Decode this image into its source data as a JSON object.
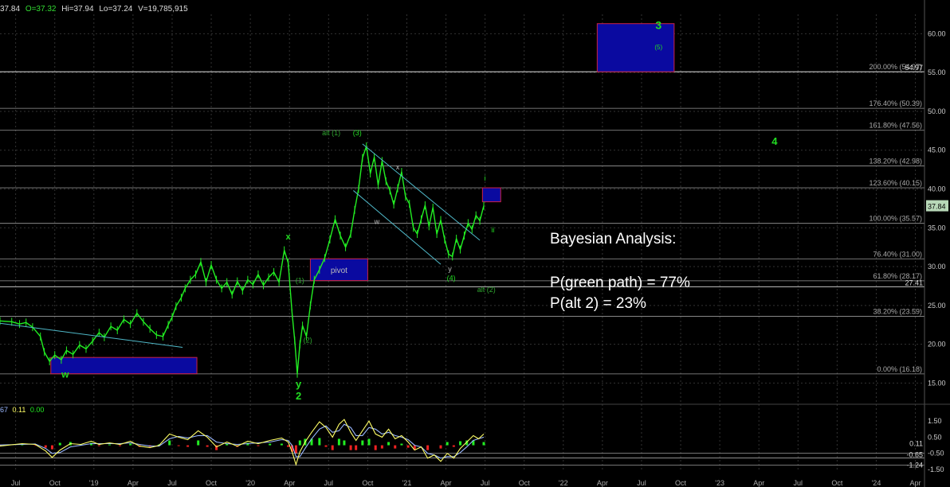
{
  "header": {
    "c_value": "37.84",
    "open": "O=37.32",
    "high": "Hi=37.94",
    "low": "Lo=37.24",
    "volume": "V=19,785,915"
  },
  "indicator_header": {
    "v1": "67",
    "v2": "0.11",
    "v3": "0.00"
  },
  "notes": {
    "title": "Bayesian Analysis:",
    "line1": "P(green path) = 77%",
    "line2": "P(alt 2) = 23%"
  },
  "colors": {
    "price": "#22ee22",
    "fib": "#9a9a9a",
    "box_fill": "#0a0aa0",
    "box_border": "#cc2244",
    "channel": "#4fb8c8",
    "label_green": "#22dd22",
    "label_dim_green": "#2fa52f",
    "label_gray": "#bbbbbb",
    "ind_fast": "#ffff66",
    "ind_slow": "#9ab8ff",
    "ind_pos": "#22ee22",
    "ind_neg": "#ee2222",
    "current_tag": "#b8d8b8"
  },
  "chart_data": [
    {
      "type": "line",
      "name": "price",
      "ylim": [
        13.5,
        62.5
      ],
      "y_ticks": [
        "60.00",
        "55.00",
        "50.00",
        "45.00",
        "40.00",
        "35.00",
        "30.00",
        "25.00",
        "20.00",
        "15.00"
      ],
      "y_tick_values": [
        60,
        55,
        50,
        45,
        40,
        35,
        30,
        25,
        20,
        15
      ],
      "x_ticks": [
        "Jul",
        "Oct",
        "'19",
        "Apr",
        "Jul",
        "Oct",
        "'20",
        "Apr",
        "Jul",
        "Oct",
        "'21",
        "Apr",
        "Jul",
        "Oct",
        "'22",
        "Apr",
        "Jul",
        "Oct",
        "'23",
        "Apr",
        "Jul",
        "Oct",
        "'24",
        "Apr"
      ],
      "x_tick_times": [
        0,
        3,
        6,
        9,
        12,
        15,
        18,
        21,
        24,
        27,
        30,
        33,
        36,
        39,
        42,
        45,
        48,
        51,
        54,
        57,
        60,
        63,
        66,
        69
      ],
      "x_range": [
        -1.2,
        69.7
      ],
      "series_points": [
        [
          -1.2,
          23.0
        ],
        [
          -0.3,
          22.9
        ],
        [
          0.3,
          22.6
        ],
        [
          0.8,
          22.8
        ],
        [
          1.3,
          22.2
        ],
        [
          1.9,
          21.0
        ],
        [
          2.2,
          19.0
        ],
        [
          2.6,
          17.8
        ],
        [
          3.0,
          18.6
        ],
        [
          3.5,
          18.0
        ],
        [
          3.9,
          19.2
        ],
        [
          4.4,
          18.7
        ],
        [
          4.9,
          19.9
        ],
        [
          5.4,
          19.4
        ],
        [
          5.9,
          20.4
        ],
        [
          6.4,
          21.5
        ],
        [
          6.8,
          20.9
        ],
        [
          7.3,
          22.3
        ],
        [
          7.8,
          21.8
        ],
        [
          8.3,
          23.2
        ],
        [
          8.8,
          22.6
        ],
        [
          9.3,
          24.0
        ],
        [
          9.8,
          22.9
        ],
        [
          10.3,
          22.0
        ],
        [
          10.8,
          21.2
        ],
        [
          11.3,
          21.0
        ],
        [
          11.7,
          22.5
        ],
        [
          12.0,
          23.5
        ],
        [
          12.3,
          24.9
        ],
        [
          12.7,
          26.0
        ],
        [
          13.0,
          27.2
        ],
        [
          13.4,
          28.3
        ],
        [
          13.8,
          29.0
        ],
        [
          14.2,
          30.6
        ],
        [
          14.6,
          28.0
        ],
        [
          15.0,
          30.2
        ],
        [
          15.4,
          28.3
        ],
        [
          15.8,
          27.2
        ],
        [
          16.2,
          28.0
        ],
        [
          16.6,
          26.4
        ],
        [
          17.0,
          28.1
        ],
        [
          17.4,
          26.9
        ],
        [
          17.8,
          28.3
        ],
        [
          18.2,
          27.7
        ],
        [
          18.6,
          29.0
        ],
        [
          19.0,
          27.6
        ],
        [
          19.4,
          28.6
        ],
        [
          19.8,
          29.3
        ],
        [
          20.2,
          28.0
        ],
        [
          20.6,
          32.1
        ],
        [
          20.9,
          30.5
        ],
        [
          21.2,
          24.0
        ],
        [
          21.4,
          20.5
        ],
        [
          21.6,
          16.2
        ],
        [
          21.8,
          20.0
        ],
        [
          22.0,
          22.4
        ],
        [
          22.3,
          21.0
        ],
        [
          22.6,
          25.0
        ],
        [
          22.9,
          28.3
        ],
        [
          23.3,
          29.6
        ],
        [
          23.7,
          31.1
        ],
        [
          24.1,
          33.5
        ],
        [
          24.5,
          36.1
        ],
        [
          24.9,
          34.0
        ],
        [
          25.3,
          32.5
        ],
        [
          25.7,
          34.2
        ],
        [
          26.0,
          37.3
        ],
        [
          26.3,
          40.0
        ],
        [
          26.6,
          44.0
        ],
        [
          26.9,
          45.5
        ],
        [
          27.2,
          42.0
        ],
        [
          27.5,
          44.1
        ],
        [
          27.8,
          40.5
        ],
        [
          28.1,
          43.6
        ],
        [
          28.4,
          41.0
        ],
        [
          28.7,
          39.8
        ],
        [
          29.0,
          38.0
        ],
        [
          29.3,
          40.1
        ],
        [
          29.6,
          42.2
        ],
        [
          29.9,
          39.0
        ],
        [
          30.2,
          38.1
        ],
        [
          30.5,
          35.0
        ],
        [
          30.8,
          34.2
        ],
        [
          31.1,
          36.1
        ],
        [
          31.4,
          37.9
        ],
        [
          31.7,
          35.2
        ],
        [
          32.0,
          37.6
        ],
        [
          32.3,
          34.2
        ],
        [
          32.6,
          36.0
        ],
        [
          32.9,
          33.5
        ],
        [
          33.2,
          31.6
        ],
        [
          33.5,
          31.3
        ],
        [
          33.8,
          33.6
        ],
        [
          34.1,
          32.2
        ],
        [
          34.4,
          34.0
        ],
        [
          34.7,
          35.6
        ],
        [
          35.0,
          34.8
        ],
        [
          35.3,
          36.6
        ],
        [
          35.6,
          35.9
        ],
        [
          35.9,
          37.84
        ]
      ],
      "fib_levels": [
        {
          "label": "200.00% (54.97)",
          "price": 55.1
        },
        {
          "label": "176.40% (50.39)",
          "price": 50.39
        },
        {
          "label": "161.80% (47.56)",
          "price": 47.56
        },
        {
          "label": "138.20% (42.98)",
          "price": 42.98
        },
        {
          "label": "123.60% (40.15)",
          "price": 40.15
        },
        {
          "label": "100.00% (35.57)",
          "price": 35.57
        },
        {
          "label": "76.40% (31.00)",
          "price": 31.0
        },
        {
          "label": "61.80% (28.17)",
          "price": 28.17
        },
        {
          "label": "38.20% (23.59)",
          "price": 23.59
        },
        {
          "label": "0.00% (16.18)",
          "price": 16.18
        }
      ],
      "extra_levels": [
        {
          "label": "54.97",
          "price": 55.1
        },
        {
          "label": "27.41",
          "price": 27.41
        }
      ],
      "current_price_tag": "37.84",
      "current_price": 37.84,
      "target_boxes": [
        {
          "name": "box-wave-3-target",
          "t0": 44.6,
          "t1": 50.5,
          "p_low": 55.1,
          "p_high": 61.3
        },
        {
          "name": "box-wave-i-target",
          "t0": 35.8,
          "t1": 37.2,
          "p_low": 38.35,
          "p_high": 40.15
        },
        {
          "name": "box-pivot",
          "t0": 22.6,
          "t1": 27.0,
          "p_low": 28.2,
          "p_high": 31.0
        },
        {
          "name": "box-wave-w",
          "t0": 2.7,
          "t1": 13.9,
          "p_low": 16.2,
          "p_high": 18.3
        }
      ],
      "channel_lines": [
        [
          [
            26.6,
            45.8
          ],
          [
            35.6,
            33.4
          ]
        ],
        [
          [
            25.9,
            39.8
          ],
          [
            32.6,
            30.3
          ]
        ],
        [
          [
            -1.2,
            22.7
          ],
          [
            12.8,
            19.6
          ]
        ]
      ],
      "wave_labels": [
        {
          "text": "3",
          "t": 49.3,
          "p": 60.6,
          "size": 14,
          "bold": true,
          "color": "label_green"
        },
        {
          "text": "(5)",
          "t": 49.3,
          "p": 58.0,
          "size": 8,
          "bold": false,
          "color": "label_green"
        },
        {
          "text": "4",
          "t": 58.2,
          "p": 45.7,
          "size": 13,
          "bold": true,
          "color": "label_green"
        },
        {
          "text": "alt (1)",
          "t": 24.2,
          "p": 46.9,
          "size": 9,
          "bold": false,
          "color": "label_dim_green"
        },
        {
          "text": "(3)",
          "t": 26.2,
          "p": 46.9,
          "size": 9,
          "bold": false,
          "color": "label_green"
        },
        {
          "text": "x",
          "t": 29.3,
          "p": 42.5,
          "size": 9,
          "bold": false,
          "color": "label_gray"
        },
        {
          "text": "w",
          "t": 27.7,
          "p": 35.5,
          "size": 9,
          "bold": false,
          "color": "label_gray"
        },
        {
          "text": "i",
          "t": 36.0,
          "p": 41.1,
          "size": 9,
          "bold": false,
          "color": "label_green"
        },
        {
          "text": "ii",
          "t": 36.6,
          "p": 34.4,
          "size": 9,
          "bold": false,
          "color": "label_green"
        },
        {
          "text": "x",
          "t": 20.9,
          "p": 33.5,
          "size": 11,
          "bold": true,
          "color": "label_green"
        },
        {
          "text": "(1)",
          "t": 21.8,
          "p": 27.9,
          "size": 9,
          "bold": false,
          "color": "label_dim_green"
        },
        {
          "text": "(2)",
          "t": 22.4,
          "p": 20.2,
          "size": 9,
          "bold": false,
          "color": "label_dim_green"
        },
        {
          "text": "y",
          "t": 21.7,
          "p": 14.4,
          "size": 13,
          "bold": true,
          "color": "label_green"
        },
        {
          "text": "2",
          "t": 21.7,
          "p": 12.9,
          "size": 13,
          "bold": true,
          "color": "label_green"
        },
        {
          "text": "y",
          "t": 33.3,
          "p": 29.4,
          "size": 9,
          "bold": false,
          "color": "label_gray"
        },
        {
          "text": "(4)",
          "t": 33.4,
          "p": 28.2,
          "size": 9,
          "bold": false,
          "color": "label_green"
        },
        {
          "text": "alt (2)",
          "t": 36.1,
          "p": 26.7,
          "size": 9,
          "bold": false,
          "color": "label_dim_green"
        },
        {
          "text": "w",
          "t": 3.8,
          "p": 15.7,
          "size": 12,
          "bold": true,
          "color": "label_green"
        },
        {
          "text": "pivot",
          "t": 24.8,
          "p": 29.2,
          "size": 10,
          "bold": false,
          "color": "label_gray"
        }
      ]
    },
    {
      "type": "line",
      "name": "indicator",
      "ylim": [
        -1.55,
        1.95
      ],
      "y_ticks": [
        "1.50",
        "0.50",
        "-0.50",
        "-1.50"
      ],
      "y_tick_values": [
        1.5,
        0.5,
        -0.5,
        -1.5
      ],
      "value_tags": [
        "-0.65",
        "0.11",
        "-1.24"
      ],
      "value_tag_values": [
        -0.58,
        0.11,
        -1.24
      ],
      "level_lines": [
        -0.5,
        -0.78,
        -1.24
      ],
      "fast_points": [
        [
          -1.2,
          -0.05
        ],
        [
          0.5,
          0.1
        ],
        [
          1.5,
          0.05
        ],
        [
          2.3,
          -0.35
        ],
        [
          2.8,
          -0.75
        ],
        [
          3.4,
          -0.3
        ],
        [
          4.2,
          0.1
        ],
        [
          5.0,
          0.05
        ],
        [
          5.8,
          0.25
        ],
        [
          6.4,
          0.05
        ],
        [
          7.2,
          0.15
        ],
        [
          8.0,
          0.05
        ],
        [
          8.8,
          0.25
        ],
        [
          9.5,
          -0.05
        ],
        [
          10.3,
          -0.15
        ],
        [
          11.0,
          0.0
        ],
        [
          11.8,
          0.7
        ],
        [
          12.5,
          0.5
        ],
        [
          13.2,
          0.35
        ],
        [
          14.0,
          0.9
        ],
        [
          14.7,
          0.5
        ],
        [
          15.4,
          -0.1
        ],
        [
          16.2,
          0.2
        ],
        [
          17.0,
          -0.05
        ],
        [
          17.8,
          0.25
        ],
        [
          18.6,
          0.1
        ],
        [
          19.5,
          0.3
        ],
        [
          20.4,
          0.45
        ],
        [
          20.9,
          0.2
        ],
        [
          21.2,
          -0.4
        ],
        [
          21.5,
          -1.2
        ],
        [
          21.8,
          -0.4
        ],
        [
          22.2,
          0.2
        ],
        [
          22.7,
          0.8
        ],
        [
          23.3,
          1.45
        ],
        [
          23.8,
          1.1
        ],
        [
          24.3,
          0.5
        ],
        [
          24.8,
          1.3
        ],
        [
          25.2,
          1.6
        ],
        [
          25.7,
          0.8
        ],
        [
          26.1,
          0.3
        ],
        [
          26.6,
          0.9
        ],
        [
          27.1,
          1.5
        ],
        [
          27.6,
          0.7
        ],
        [
          28.1,
          0.5
        ],
        [
          28.6,
          1.0
        ],
        [
          29.1,
          0.4
        ],
        [
          29.6,
          0.6
        ],
        [
          30.1,
          0.2
        ],
        [
          30.6,
          -0.3
        ],
        [
          31.1,
          -0.1
        ],
        [
          31.6,
          -0.8
        ],
        [
          32.1,
          -0.6
        ],
        [
          32.6,
          -1.0
        ],
        [
          33.1,
          -0.5
        ],
        [
          33.6,
          -0.8
        ],
        [
          34.1,
          -0.2
        ],
        [
          34.6,
          0.2
        ],
        [
          35.1,
          0.6
        ],
        [
          35.5,
          0.4
        ],
        [
          35.9,
          0.7
        ]
      ],
      "slow_points": [
        [
          -1.2,
          0.02
        ],
        [
          0.5,
          0.05
        ],
        [
          1.5,
          0.08
        ],
        [
          2.3,
          -0.2
        ],
        [
          2.8,
          -0.5
        ],
        [
          3.4,
          -0.45
        ],
        [
          4.2,
          -0.1
        ],
        [
          5.0,
          0.0
        ],
        [
          5.8,
          0.1
        ],
        [
          6.4,
          0.1
        ],
        [
          7.2,
          0.1
        ],
        [
          8.0,
          0.1
        ],
        [
          8.8,
          0.15
        ],
        [
          9.5,
          0.05
        ],
        [
          10.3,
          -0.05
        ],
        [
          11.0,
          -0.05
        ],
        [
          11.8,
          0.4
        ],
        [
          12.5,
          0.55
        ],
        [
          13.2,
          0.45
        ],
        [
          14.0,
          0.6
        ],
        [
          14.7,
          0.6
        ],
        [
          15.4,
          0.2
        ],
        [
          16.2,
          0.1
        ],
        [
          17.0,
          0.05
        ],
        [
          17.8,
          0.1
        ],
        [
          18.6,
          0.15
        ],
        [
          19.5,
          0.2
        ],
        [
          20.4,
          0.35
        ],
        [
          20.9,
          0.3
        ],
        [
          21.2,
          0.0
        ],
        [
          21.5,
          -0.7
        ],
        [
          21.8,
          -0.7
        ],
        [
          22.2,
          -0.2
        ],
        [
          22.7,
          0.4
        ],
        [
          23.3,
          1.0
        ],
        [
          23.8,
          1.2
        ],
        [
          24.3,
          0.8
        ],
        [
          24.8,
          0.9
        ],
        [
          25.2,
          1.3
        ],
        [
          25.7,
          1.1
        ],
        [
          26.1,
          0.6
        ],
        [
          26.6,
          0.6
        ],
        [
          27.1,
          1.1
        ],
        [
          27.6,
          1.0
        ],
        [
          28.1,
          0.7
        ],
        [
          28.6,
          0.8
        ],
        [
          29.1,
          0.6
        ],
        [
          29.6,
          0.5
        ],
        [
          30.1,
          0.35
        ],
        [
          30.6,
          0.0
        ],
        [
          31.1,
          -0.1
        ],
        [
          31.6,
          -0.5
        ],
        [
          32.1,
          -0.6
        ],
        [
          32.6,
          -0.8
        ],
        [
          33.1,
          -0.7
        ],
        [
          33.6,
          -0.7
        ],
        [
          34.1,
          -0.45
        ],
        [
          34.6,
          -0.1
        ],
        [
          35.1,
          0.3
        ],
        [
          35.5,
          0.4
        ],
        [
          35.9,
          0.5
        ]
      ]
    }
  ]
}
